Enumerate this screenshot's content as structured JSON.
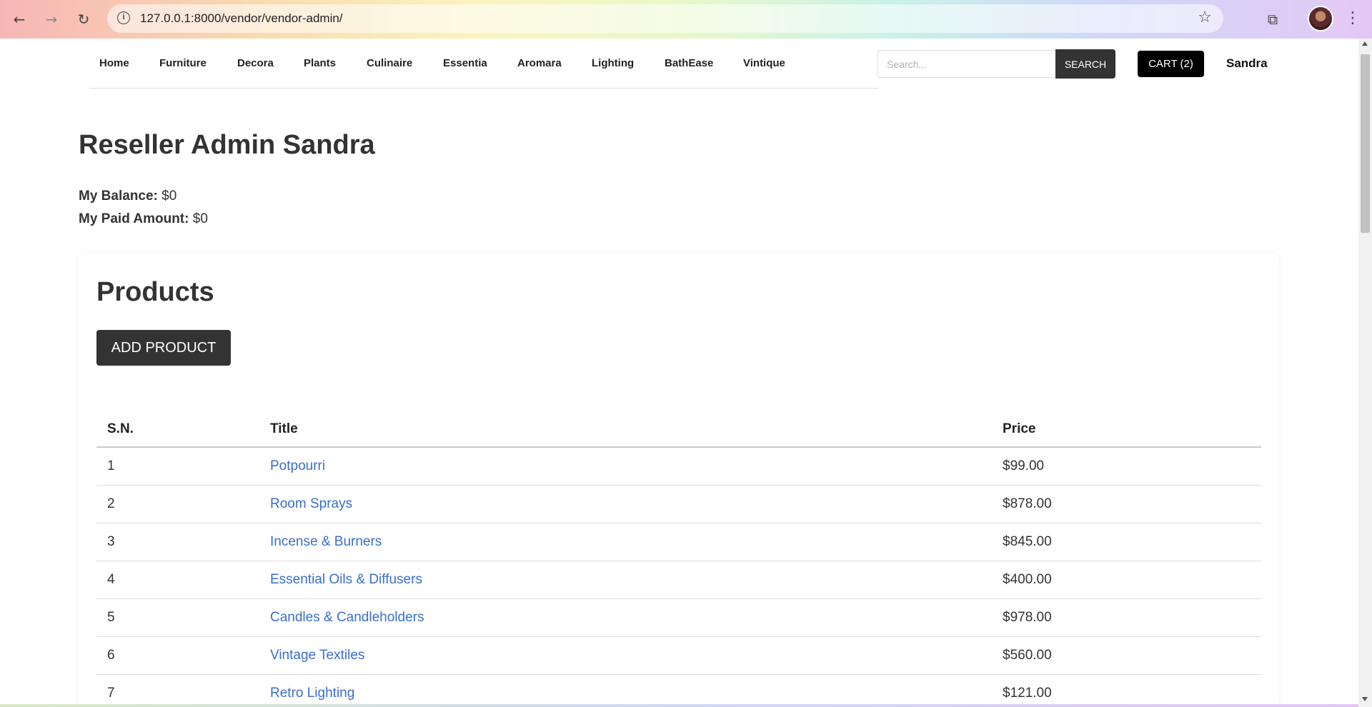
{
  "browser": {
    "url": "127.0.0.1:8000/vendor/vendor-admin/",
    "back_icon": "←",
    "forward_icon": "→",
    "reload_icon": "↻",
    "info_icon": "i",
    "star_icon": "☆",
    "extensions_icon": "⧉",
    "menu_icon": "⋮"
  },
  "nav": {
    "items": [
      "Home",
      "Furniture",
      "Decora",
      "Plants",
      "Culinaire",
      "Essentia",
      "Aromara",
      "Lighting",
      "BathEase",
      "Vintique"
    ],
    "search_placeholder": "Search...",
    "search_label": "SEARCH",
    "cart_label": "CART (2)",
    "user": "Sandra"
  },
  "page": {
    "title": "Reseller Admin Sandra",
    "balance_label": "My Balance:",
    "balance_value": "$0",
    "paid_label": "My Paid Amount:",
    "paid_value": "$0"
  },
  "products": {
    "title": "Products",
    "add_label": "ADD PRODUCT",
    "columns": [
      "S.N.",
      "Title",
      "Price"
    ],
    "rows": [
      {
        "sn": "1",
        "title": "Potpourri",
        "price": "$99.00"
      },
      {
        "sn": "2",
        "title": "Room Sprays",
        "price": "$878.00"
      },
      {
        "sn": "3",
        "title": "Incense & Burners",
        "price": "$845.00"
      },
      {
        "sn": "4",
        "title": "Essential Oils & Diffusers",
        "price": "$400.00"
      },
      {
        "sn": "5",
        "title": "Candles & Candleholders",
        "price": "$978.00"
      },
      {
        "sn": "6",
        "title": "Vintage Textiles",
        "price": "$560.00"
      },
      {
        "sn": "7",
        "title": "Retro Lighting",
        "price": "$121.00"
      }
    ]
  },
  "colors": {
    "link": "#3a6fc8",
    "button_dark": "#333333",
    "cart_bg": "#000000"
  }
}
